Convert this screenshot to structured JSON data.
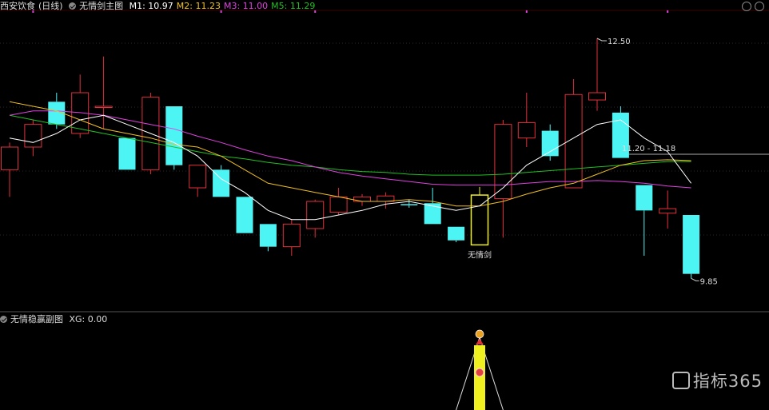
{
  "header": {
    "stock_name": "西安饮食",
    "period": "(日线)",
    "main_indicator": "无情剑主图",
    "ma_labels": [
      {
        "label": "M1: 10.97",
        "color": "#ffffff"
      },
      {
        "label": "M2: 11.23",
        "color": "#f0c020"
      },
      {
        "label": "M3: 11.00",
        "color": "#e040e0"
      },
      {
        "label": "M5: 11.29",
        "color": "#20c020"
      }
    ]
  },
  "sub_header": {
    "indicator": "无情稳赢副图",
    "value": "XG: 0.00"
  },
  "watermark": {
    "text": "指标365"
  },
  "chart_data": {
    "type": "candlestick",
    "y_range": [
      9.5,
      12.8
    ],
    "annotations": {
      "high_label": "12.50",
      "low_label": "9.85",
      "price_tag": "11.20 - 11.18",
      "signal_label": "无情剑"
    },
    "candles": [
      {
        "o": 11.05,
        "h": 11.35,
        "l": 10.75,
        "c": 11.3
      },
      {
        "o": 11.3,
        "h": 11.6,
        "l": 11.2,
        "c": 11.55
      },
      {
        "o": 11.8,
        "h": 11.9,
        "l": 11.5,
        "c": 11.55
      },
      {
        "o": 11.45,
        "h": 12.1,
        "l": 11.4,
        "c": 11.9
      },
      {
        "o": 11.75,
        "h": 12.3,
        "l": 11.5,
        "c": 11.75
      },
      {
        "o": 11.4,
        "h": 11.4,
        "l": 11.05,
        "c": 11.05
      },
      {
        "o": 11.05,
        "h": 11.9,
        "l": 11.0,
        "c": 11.85
      },
      {
        "o": 11.75,
        "h": 11.75,
        "l": 11.05,
        "c": 11.1
      },
      {
        "o": 10.85,
        "h": 11.1,
        "l": 10.75,
        "c": 11.1
      },
      {
        "o": 11.05,
        "h": 11.1,
        "l": 10.75,
        "c": 10.75
      },
      {
        "o": 10.75,
        "h": 10.75,
        "l": 10.35,
        "c": 10.35
      },
      {
        "o": 10.45,
        "h": 10.45,
        "l": 10.15,
        "c": 10.2
      },
      {
        "o": 10.2,
        "h": 10.5,
        "l": 10.1,
        "c": 10.45
      },
      {
        "o": 10.4,
        "h": 10.72,
        "l": 10.3,
        "c": 10.7
      },
      {
        "o": 10.58,
        "h": 10.85,
        "l": 10.55,
        "c": 10.75
      },
      {
        "o": 10.7,
        "h": 10.78,
        "l": 10.65,
        "c": 10.75
      },
      {
        "o": 10.7,
        "h": 10.8,
        "l": 10.62,
        "c": 10.76
      },
      {
        "o": 10.67,
        "h": 10.72,
        "l": 10.63,
        "c": 10.66
      },
      {
        "o": 10.68,
        "h": 10.85,
        "l": 10.45,
        "c": 10.45
      },
      {
        "o": 10.42,
        "h": 10.42,
        "l": 10.25,
        "c": 10.27
      },
      {
        "o": 10.22,
        "h": 10.86,
        "l": 10.22,
        "c": 10.77
      },
      {
        "o": 10.73,
        "h": 11.6,
        "l": 10.3,
        "c": 11.55
      },
      {
        "o": 11.4,
        "h": 11.9,
        "l": 11.3,
        "c": 11.57
      },
      {
        "o": 11.48,
        "h": 11.55,
        "l": 11.15,
        "c": 11.2
      },
      {
        "o": 10.85,
        "h": 12.05,
        "l": 10.85,
        "c": 11.88
      },
      {
        "o": 11.82,
        "h": 12.5,
        "l": 11.7,
        "c": 11.9
      },
      {
        "o": 11.68,
        "h": 11.75,
        "l": 11.18,
        "c": 11.18
      },
      {
        "o": 10.88,
        "h": 10.88,
        "l": 10.1,
        "c": 10.6
      },
      {
        "o": 10.57,
        "h": 10.82,
        "l": 10.4,
        "c": 10.62
      },
      {
        "o": 10.55,
        "h": 10.55,
        "l": 9.85,
        "c": 9.9
      }
    ],
    "signal_index": 20,
    "m1": [
      11.4,
      11.35,
      11.45,
      11.6,
      11.65,
      11.55,
      11.45,
      11.35,
      11.2,
      10.95,
      10.8,
      10.6,
      10.5,
      10.5,
      10.55,
      10.6,
      10.67,
      10.7,
      10.65,
      10.6,
      10.65,
      10.85,
      11.1,
      11.25,
      11.4,
      11.55,
      11.6,
      11.4,
      11.25,
      10.9
    ],
    "m2": [
      11.8,
      11.75,
      11.7,
      11.6,
      11.5,
      11.45,
      11.4,
      11.33,
      11.3,
      11.2,
      11.05,
      10.9,
      10.85,
      10.8,
      10.75,
      10.7,
      10.7,
      10.72,
      10.7,
      10.65,
      10.65,
      10.7,
      10.78,
      10.85,
      10.9,
      11.0,
      11.1,
      11.15,
      11.16,
      11.15
    ],
    "m3": [
      11.65,
      11.7,
      11.7,
      11.68,
      11.65,
      11.6,
      11.55,
      11.5,
      11.42,
      11.35,
      11.27,
      11.2,
      11.15,
      11.08,
      11.02,
      10.98,
      10.95,
      10.92,
      10.89,
      10.88,
      10.88,
      10.88,
      10.9,
      10.92,
      10.92,
      10.93,
      10.92,
      10.9,
      10.87,
      10.85
    ],
    "m5": [
      11.65,
      11.6,
      11.55,
      11.5,
      11.45,
      11.4,
      11.35,
      11.3,
      11.25,
      11.2,
      11.17,
      11.13,
      11.1,
      11.08,
      11.05,
      11.03,
      11.02,
      11.0,
      10.99,
      10.99,
      10.99,
      11.0,
      11.02,
      11.04,
      11.06,
      11.08,
      11.1,
      11.12,
      11.14,
      11.14
    ]
  },
  "colors": {
    "up": "#e0303a",
    "down": "#4cf4f4",
    "signal": "#f0f020",
    "m1": "#ffffff",
    "m2": "#f0c020",
    "m3": "#e040e0",
    "m5": "#20c020"
  }
}
